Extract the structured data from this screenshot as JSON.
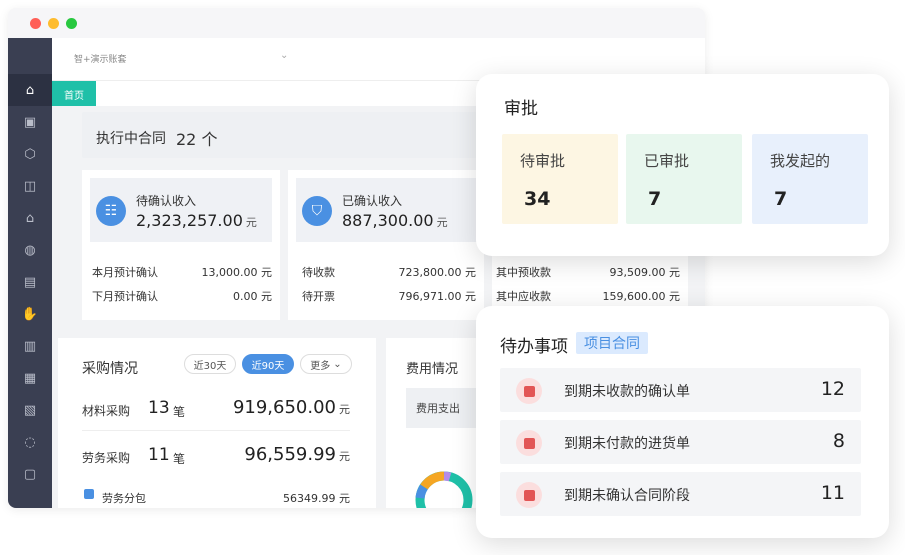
{
  "app": {
    "account_selector": "智+演示账套",
    "tab_home": "首页"
  },
  "sidebar_icons": [
    "home-icon",
    "gift-icon",
    "hex-icon",
    "bag-icon",
    "house-icon",
    "money-bag-icon",
    "invoice-icon",
    "hand-icon",
    "document-icon",
    "clipboard-icon",
    "report-icon",
    "cycle-icon",
    "chat-icon"
  ],
  "contract": {
    "label": "执行中合同",
    "count": "22 个"
  },
  "income": [
    {
      "title": "待确认收入",
      "amount": "2,323,257.00",
      "unit": "元",
      "rows": [
        {
          "label": "本月预计确认",
          "value": "13,000.00 元"
        },
        {
          "label": "下月预计确认",
          "value": "0.00 元"
        }
      ]
    },
    {
      "title": "已确认收入",
      "amount": "887,300.00",
      "unit": "元",
      "rows": [
        {
          "label": "待收款",
          "value": "723,800.00 元"
        },
        {
          "label": "待开票",
          "value": "796,971.00 元"
        }
      ]
    },
    {
      "rows": [
        {
          "label": "其中预收款",
          "value": "93,509.00 元"
        },
        {
          "label": "其中应收款",
          "value": "159,600.00 元"
        }
      ]
    }
  ],
  "purchase": {
    "title": "采购情况",
    "filters": [
      "近30天",
      "近90天",
      "更多"
    ],
    "rows": [
      {
        "label": "材料采购",
        "count": "13",
        "unit": "笔",
        "amount": "919,650.00",
        "currency": "元"
      },
      {
        "label": "劳务采购",
        "count": "11",
        "unit": "笔",
        "amount": "96,559.99",
        "currency": "元"
      }
    ],
    "legend": {
      "label": "劳务分包",
      "value": "56349.99 元",
      "color": "#4a90e2"
    }
  },
  "expense": {
    "title": "费用情况",
    "subtitle": "费用支出"
  },
  "approval": {
    "title": "审批",
    "items": [
      {
        "label": "待审批",
        "value": "34",
        "bg": "#fdf6e3"
      },
      {
        "label": "已审批",
        "value": "7",
        "bg": "#e8f7ee"
      },
      {
        "label": "我发起的",
        "value": "7",
        "bg": "#e8f0fc"
      }
    ]
  },
  "todo": {
    "title": "待办事项",
    "tag": "项目合同",
    "items": [
      {
        "label": "到期未收款的确认单",
        "count": "12"
      },
      {
        "label": "到期未付款的进货单",
        "count": "8"
      },
      {
        "label": "到期未确认合同阶段",
        "count": "11"
      }
    ]
  },
  "colors": {
    "accent_green": "#1fc0a8",
    "accent_blue": "#4a90e2",
    "sidebar": "#3a3f52"
  }
}
